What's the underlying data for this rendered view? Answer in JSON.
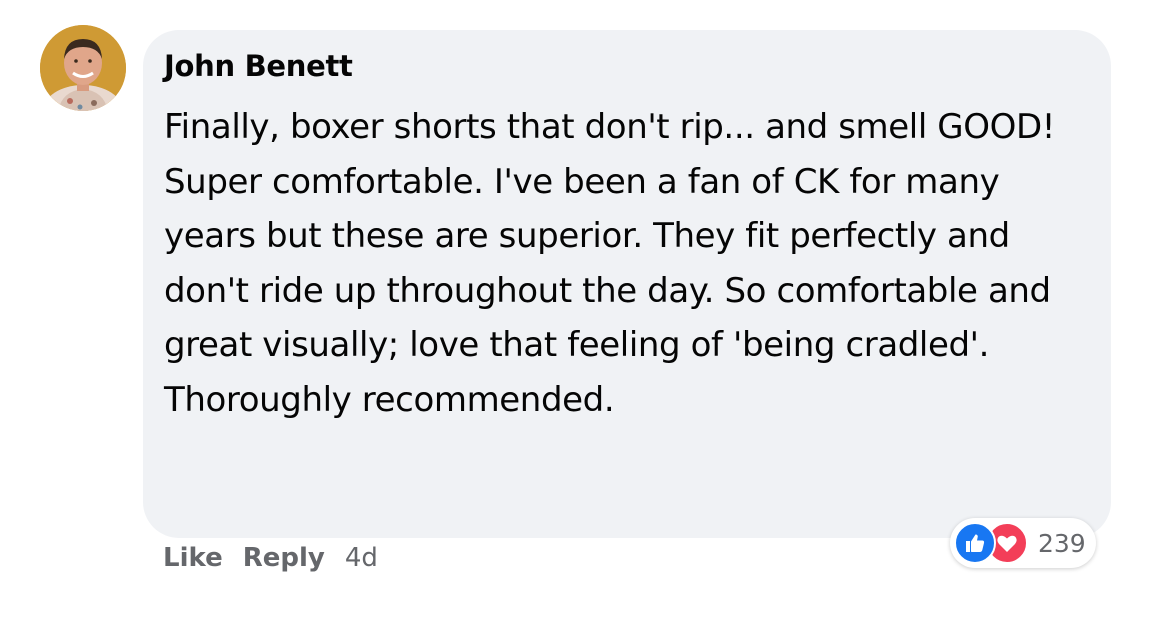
{
  "comment": {
    "author": "John Benett",
    "text": "Finally, boxer shorts that don't rip... and smell GOOD! Super comfortable. I've been a fan of CK for many years but these are superior. They fit perfectly and don't ride up throughout the day. So comfortable and great visually; love that feeling of 'being cradled'. Thoroughly recommended.",
    "bubble_color": "#f0f2f5"
  },
  "reactions": {
    "icons": [
      "like-icon",
      "love-icon"
    ],
    "count": "239",
    "like_color": "#1877f2",
    "love_color": "#f33e58"
  },
  "actions": {
    "like_label": "Like",
    "reply_label": "Reply",
    "timestamp": "4d"
  }
}
